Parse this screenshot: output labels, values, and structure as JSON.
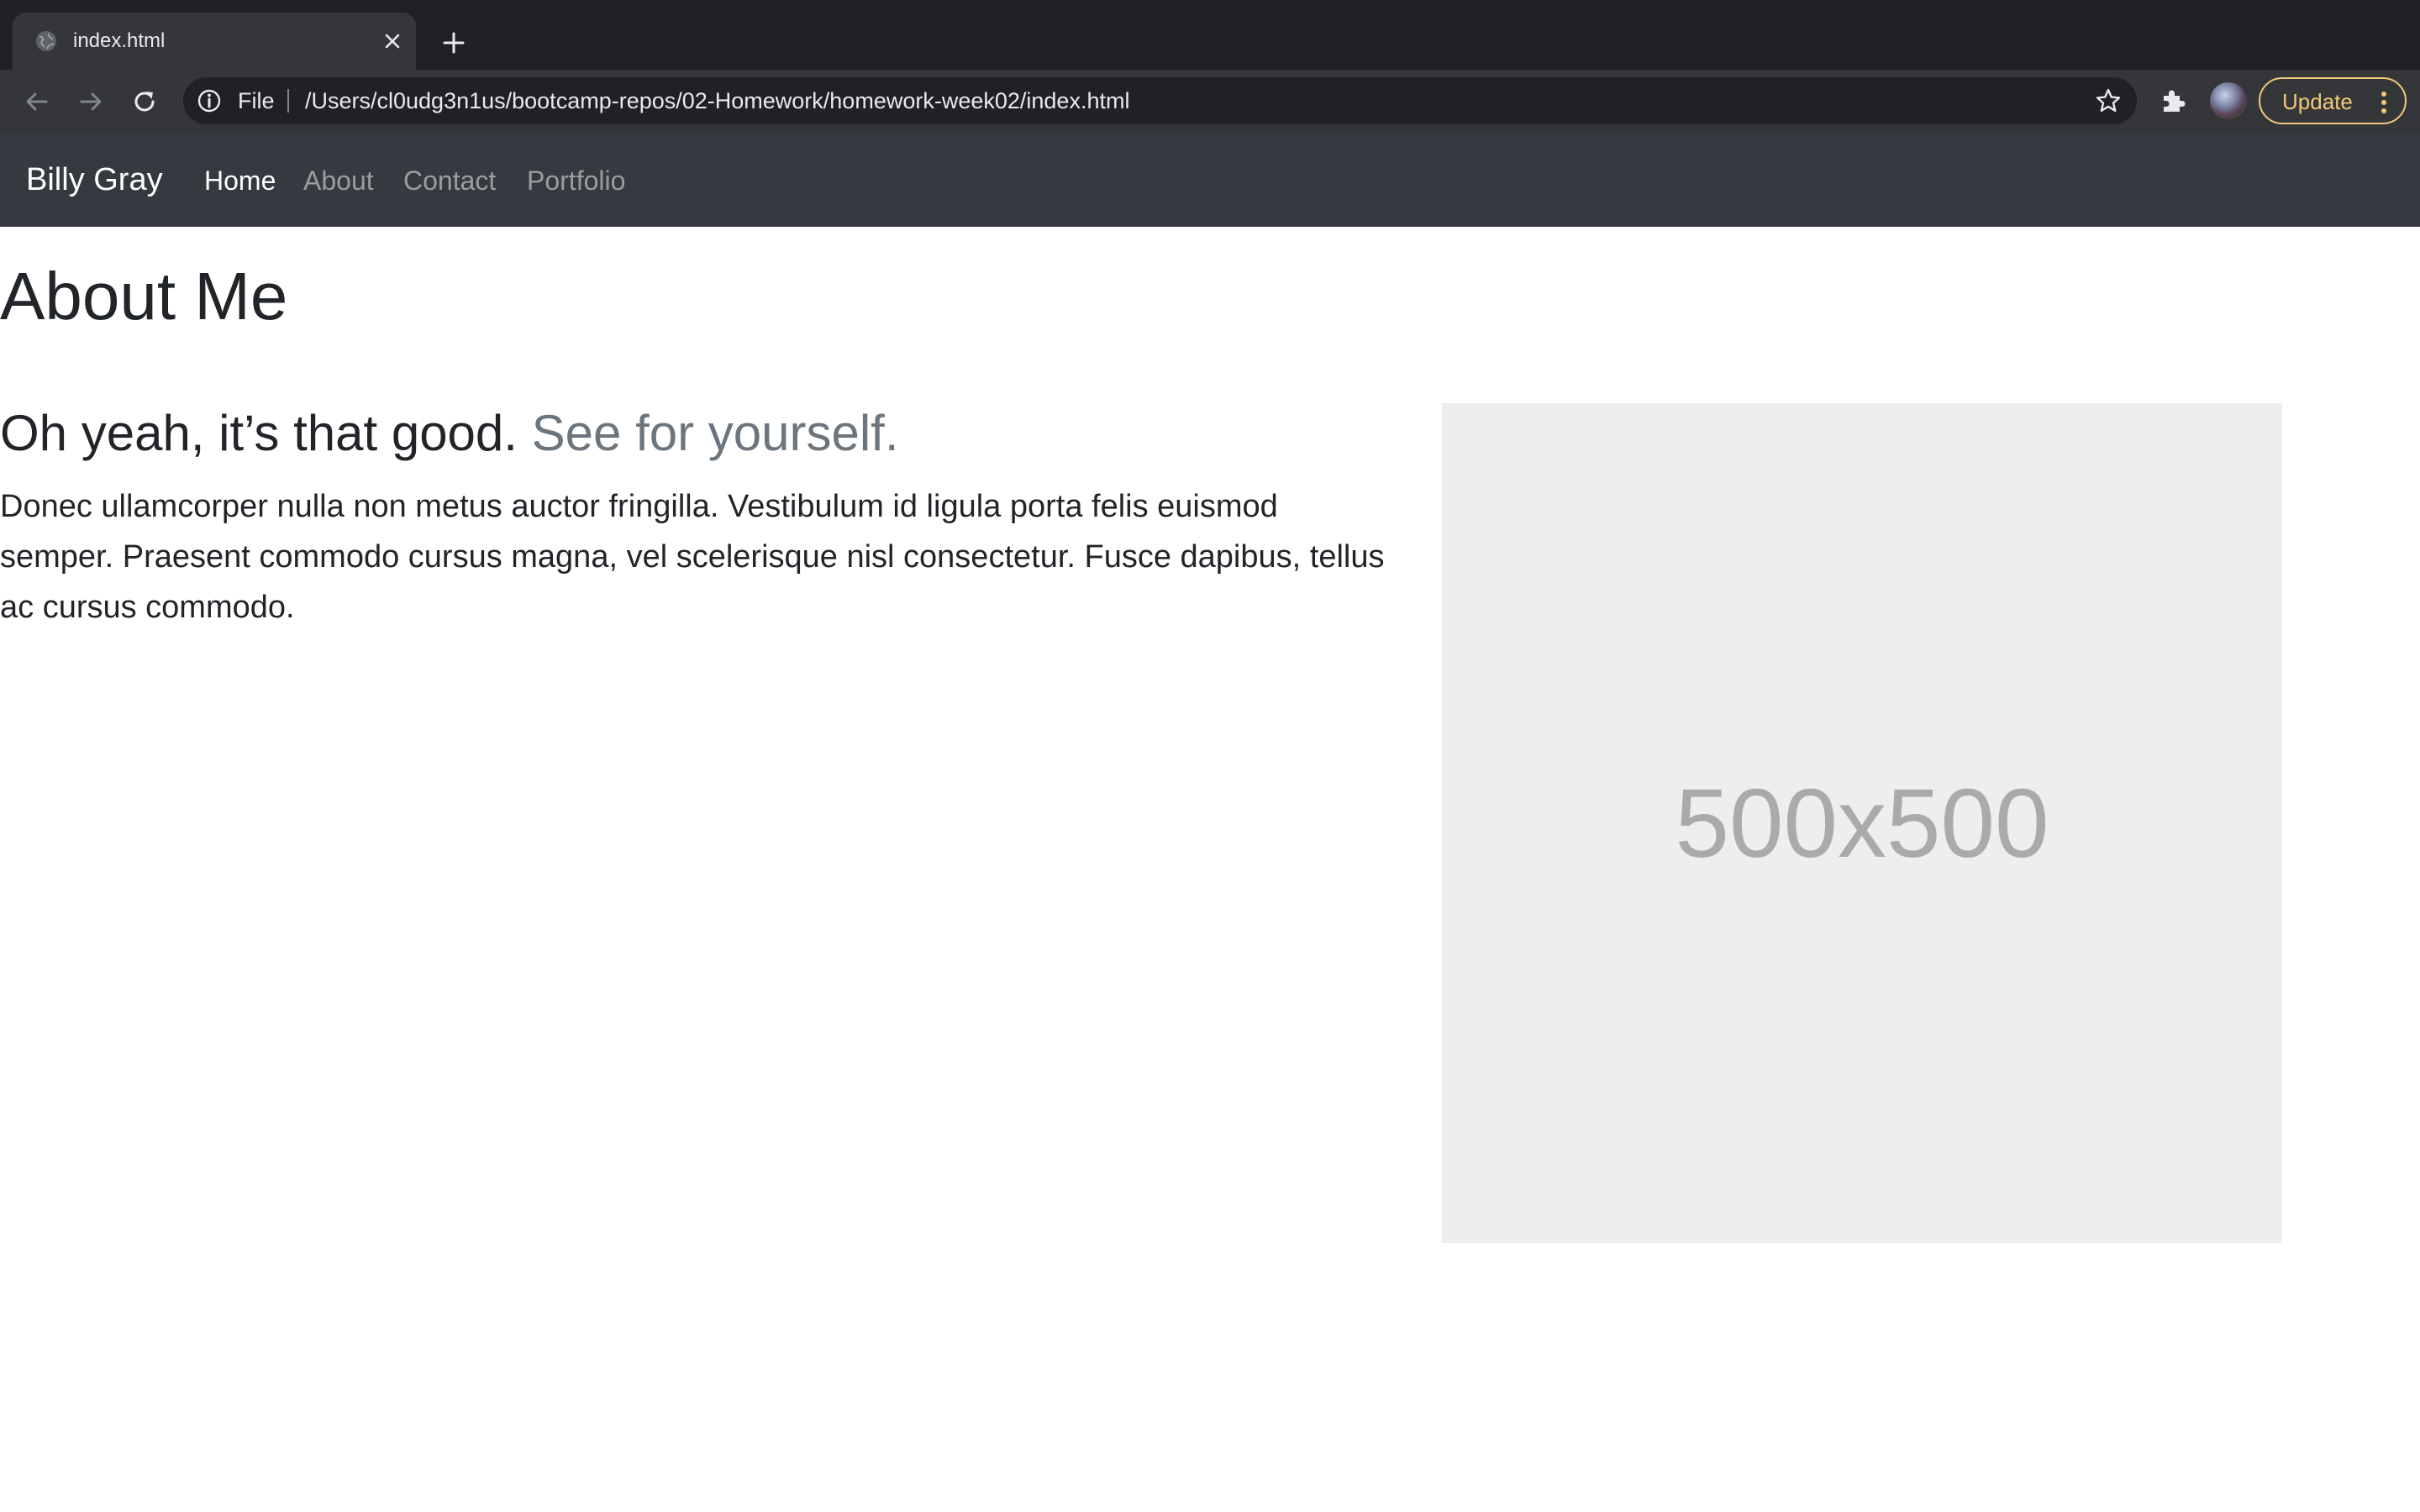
{
  "browser": {
    "tab": {
      "title": "index.html"
    },
    "omnibox": {
      "scheme_label": "File",
      "url": "/Users/cl0udg3n1us/bootcamp-repos/02-Homework/homework-week02/index.html"
    },
    "update_button": {
      "label": "Update"
    },
    "accent_color": "#f1c977"
  },
  "navbar": {
    "brand": "Billy Gray",
    "links": [
      {
        "label": "Home",
        "active": true
      },
      {
        "label": "About",
        "active": false
      },
      {
        "label": "Contact",
        "active": false
      },
      {
        "label": "Portfolio",
        "active": false
      }
    ],
    "background": "#343a40"
  },
  "main": {
    "heading": "About Me",
    "feature": {
      "heading": "Oh yeah, it’s that good.",
      "heading_muted": "See for yourself.",
      "lead": "Donec ullamcorper nulla non metus auctor fringilla. Vestibulum id ligula porta felis euismod semper. Praesent commodo cursus magna, vel scelerisque nisl consectetur. Fusce dapibus, tellus ac cursus commodo.",
      "image_placeholder_text": "500x500"
    }
  }
}
